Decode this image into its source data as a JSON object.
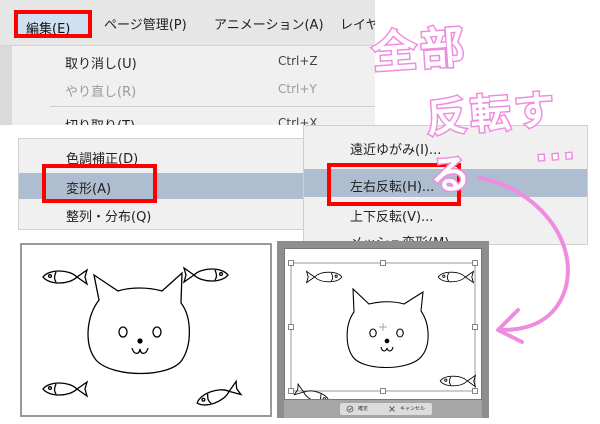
{
  "menubar": {
    "edit": "編集(E)",
    "page": "ページ管理(P)",
    "animation": "アニメーション(A)",
    "layer_partial": "レイヤ"
  },
  "edit_menu": [
    {
      "label": "取り消し(U)",
      "shortcut": "Ctrl+Z",
      "enabled": true
    },
    {
      "label": "やり直し(R)",
      "shortcut": "Ctrl+Y",
      "enabled": false
    },
    {
      "label": "切り取り(T)",
      "shortcut": "Ctrl+X",
      "enabled": true
    }
  ],
  "submenu_left": [
    {
      "label": "色調補正(D)"
    },
    {
      "label": "変形(A)"
    },
    {
      "label": "整列・分布(Q)"
    }
  ],
  "submenu_right": [
    {
      "label": "遠近ゆがみ(I)..."
    },
    {
      "label": "左右反転(H)..."
    },
    {
      "label": "上下反転(V)..."
    },
    {
      "label": "メッシュ変形(M)..."
    }
  ],
  "annotation": {
    "line1": "全部",
    "line2": "反転する",
    "dots": "..."
  },
  "confirm_bar": {
    "ok": "確定",
    "cancel": "キャンセル"
  },
  "colors": {
    "highlight": "#ff0000",
    "annotation": "#f08ce0",
    "menu_selected": "#aebdd0"
  }
}
